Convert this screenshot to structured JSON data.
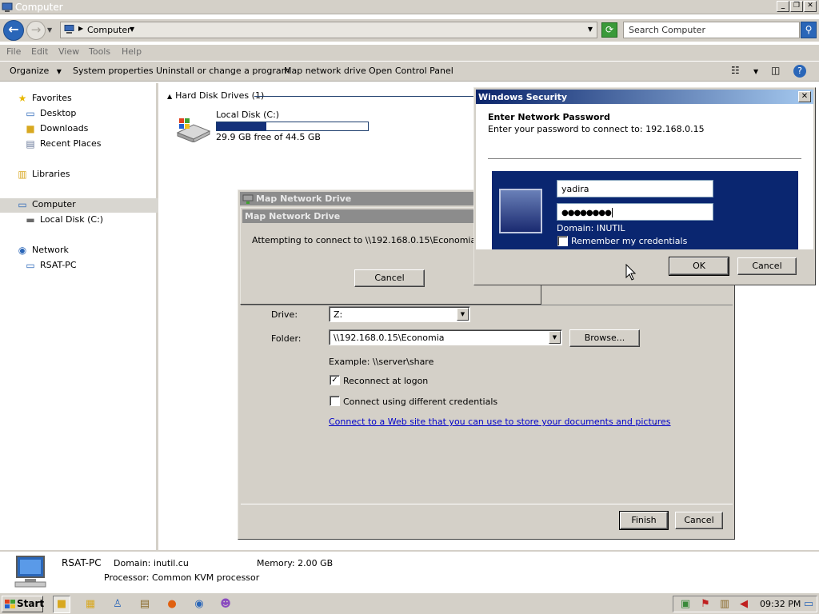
{
  "window": {
    "title": "Computer"
  },
  "address": {
    "location": "Computer",
    "search_placeholder": "Search Computer"
  },
  "menu": {
    "file": "File",
    "edit": "Edit",
    "view": "View",
    "tools": "Tools",
    "help": "Help"
  },
  "toolbar": {
    "organize": "Organize",
    "system_properties": "System properties",
    "uninstall": "Uninstall or change a program",
    "map_drive": "Map network drive",
    "control_panel": "Open Control Panel"
  },
  "sidebar": {
    "items": [
      {
        "label": "Favorites",
        "icon": "star-icon"
      },
      {
        "label": "Desktop",
        "icon": "desktop-icon"
      },
      {
        "label": "Downloads",
        "icon": "folder-icon"
      },
      {
        "label": "Recent Places",
        "icon": "recent-places-icon"
      },
      {
        "label": "Libraries",
        "icon": "libraries-icon"
      },
      {
        "label": "Computer",
        "icon": "computer-icon",
        "selected": true
      },
      {
        "label": "Local Disk (C:)",
        "icon": "disk-icon"
      },
      {
        "label": "Network",
        "icon": "network-icon"
      },
      {
        "label": "RSAT-PC",
        "icon": "computer-icon"
      }
    ]
  },
  "content": {
    "group_header": "Hard Disk Drives (1)",
    "disk": {
      "name": "Local Disk (C:)",
      "free_text": "29.9 GB free of 44.5 GB",
      "used_fraction": 0.33
    }
  },
  "details": {
    "pc_name": "RSAT-PC",
    "domain": "Domain: inutil.cu",
    "memory": "Memory: 2.00 GB",
    "processor": "Processor: Common KVM processor"
  },
  "wizard": {
    "title": "Map Network Drive",
    "drive_label": "Drive:",
    "drive_value": "Z:",
    "folder_label": "Folder:",
    "folder_value": "\\\\192.168.0.15\\Economia",
    "browse": "Browse...",
    "example": "Example: \\\\server\\share",
    "reconnect": "Reconnect at logon",
    "reconnect_checked": true,
    "diff_creds": "Connect using different credentials",
    "diff_creds_checked": false,
    "link": "Connect to a Web site that you can use to store your documents and pictures",
    "link_period": ".",
    "finish": "Finish",
    "cancel": "Cancel"
  },
  "connecting": {
    "title": "Map Network Drive",
    "message": "Attempting to connect to \\\\192.168.0.15\\Economia...",
    "cancel": "Cancel"
  },
  "security": {
    "title": "Windows Security",
    "heading": "Enter Network Password",
    "subheading": "Enter your password to connect to: 192.168.0.15",
    "username": "yadira",
    "password_mask": "●●●●●●●●",
    "domain": "Domain: INUTIL",
    "remember": "Remember my credentials",
    "remember_checked": false,
    "ok": "OK",
    "cancel": "Cancel"
  },
  "taskbar": {
    "start": "Start",
    "clock": "09:32 PM"
  },
  "colors": {
    "selection": "#14317a",
    "security_title_start": "#0a246a",
    "credential_panel": "#0a2670",
    "link": "#0000c8"
  }
}
